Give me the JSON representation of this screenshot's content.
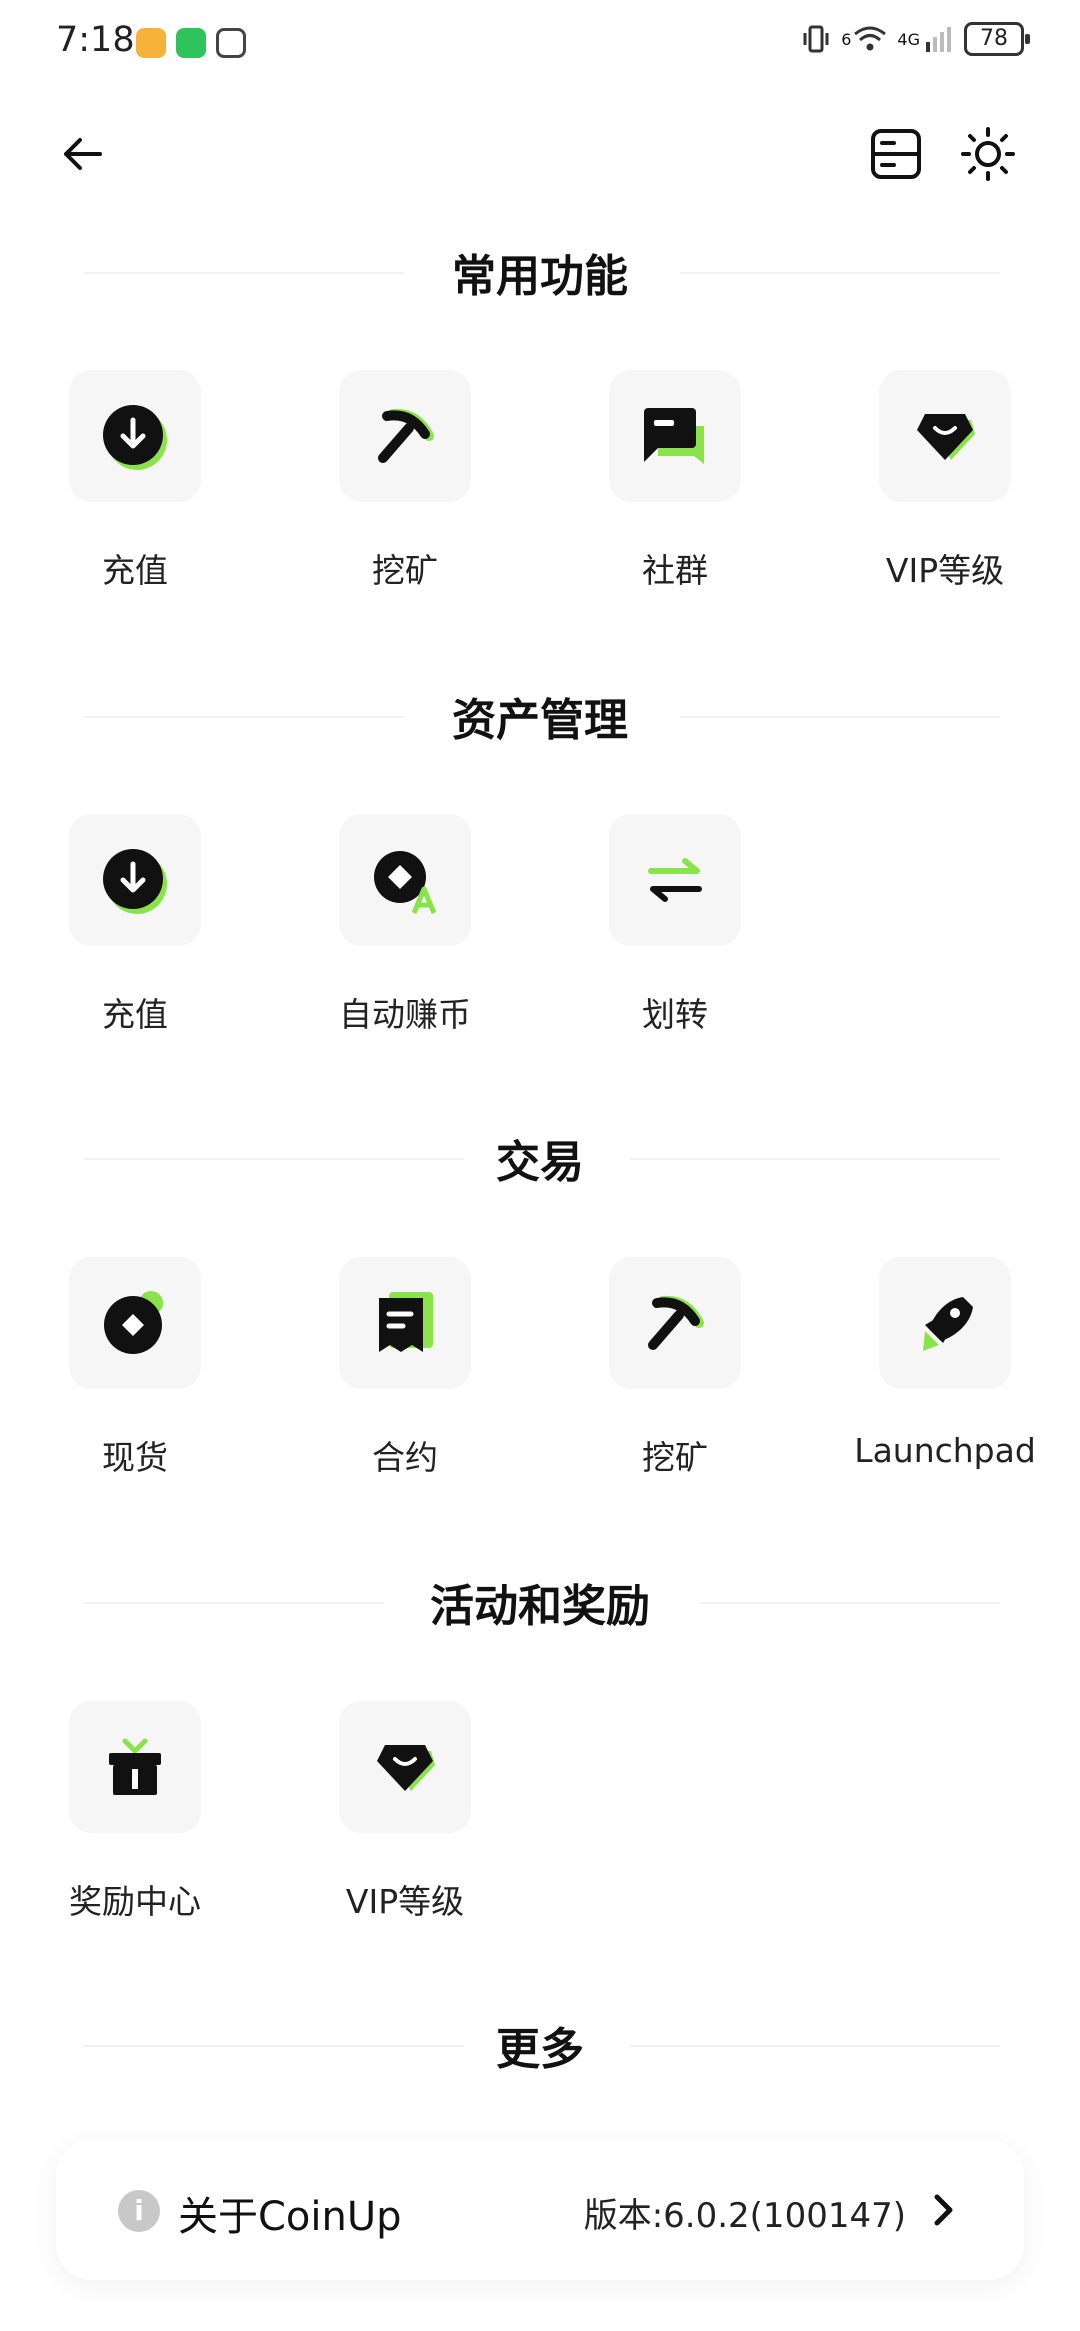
{
  "status_bar": {
    "time": "7:18",
    "battery": "78",
    "network": "4G",
    "signal_sup": "6"
  },
  "topbar": {
    "back_icon": "arrow-left-icon",
    "list_icon": "list-card-icon",
    "theme_icon": "sun-icon"
  },
  "colors": {
    "accent": "#8ae34a",
    "icon_dark": "#111111",
    "tile_bg": "#f6f6f6"
  },
  "sections": [
    {
      "title": "常用功能",
      "items": [
        {
          "label": "充值",
          "icon": "deposit-icon"
        },
        {
          "label": "挖矿",
          "icon": "mining-icon"
        },
        {
          "label": "社群",
          "icon": "community-icon"
        },
        {
          "label": "VIP等级",
          "icon": "vip-icon"
        }
      ]
    },
    {
      "title": "资产管理",
      "items": [
        {
          "label": "充值",
          "icon": "deposit-icon"
        },
        {
          "label": "自动赚币",
          "icon": "auto-earn-icon"
        },
        {
          "label": "划转",
          "icon": "transfer-icon"
        }
      ]
    },
    {
      "title": "交易",
      "items": [
        {
          "label": "现货",
          "icon": "spot-icon"
        },
        {
          "label": "合约",
          "icon": "contract-icon"
        },
        {
          "label": "挖矿",
          "icon": "mining-icon"
        },
        {
          "label": "Launchpad",
          "icon": "rocket-icon"
        }
      ]
    },
    {
      "title": "活动和奖励",
      "items": [
        {
          "label": "奖励中心",
          "icon": "gift-icon"
        },
        {
          "label": "VIP等级",
          "icon": "vip-icon"
        }
      ]
    },
    {
      "title": "更多",
      "items": []
    }
  ],
  "about": {
    "label": "关于CoinUp",
    "version": "版本:6.0.2(100147)",
    "info_icon": "info-icon",
    "chevron_icon": "chevron-right-icon"
  }
}
